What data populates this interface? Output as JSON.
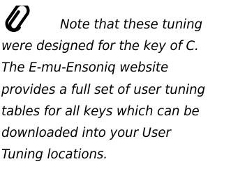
{
  "note": {
    "icon": "paperclip-icon",
    "lines": [
      "Note that these tuning",
      "were designed for the key of C.",
      "The E-mu-Ensoniq website",
      "provides a full set of user tuning",
      "tables for all keys which can be",
      "downloaded into your User",
      "Tuning locations."
    ]
  }
}
